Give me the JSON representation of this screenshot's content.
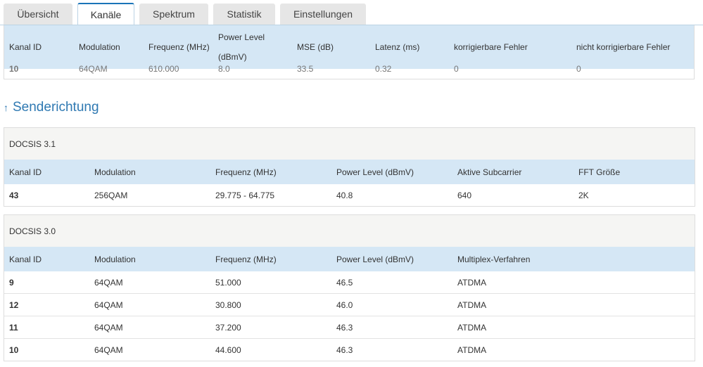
{
  "tabs": [
    {
      "label": "Übersicht",
      "active": false
    },
    {
      "label": "Kanäle",
      "active": true
    },
    {
      "label": "Spektrum",
      "active": false
    },
    {
      "label": "Statistik",
      "active": false
    },
    {
      "label": "Einstellungen",
      "active": false
    }
  ],
  "downstream": {
    "headers": [
      "Kanal ID",
      "Modulation",
      "Frequenz (MHz)",
      "Power Level",
      "(dBmV)",
      "MSE (dB)",
      "Latenz (ms)",
      "korrigierbare Fehler",
      "nicht korrigierbare Fehler"
    ],
    "partial_row": [
      "10",
      "64QAM",
      "610.000",
      "8.0",
      "33.5",
      "0.32",
      "0",
      "0"
    ]
  },
  "upstream": {
    "title": "Senderichtung",
    "arrow": "↑",
    "docsis31": {
      "title": "DOCSIS 3.1",
      "headers": [
        "Kanal ID",
        "Modulation",
        "Frequenz (MHz)",
        "Power Level (dBmV)",
        "Aktive Subcarrier",
        "FFT Größe"
      ],
      "rows": [
        [
          "43",
          "256QAM",
          "29.775 - 64.775",
          "40.8",
          "640",
          "2K"
        ]
      ]
    },
    "docsis30": {
      "title": "DOCSIS 3.0",
      "headers": [
        "Kanal ID",
        "Modulation",
        "Frequenz (MHz)",
        "Power Level (dBmV)",
        "Multiplex-Verfahren"
      ],
      "rows": [
        [
          "9",
          "64QAM",
          "51.000",
          "46.5",
          "ATDMA"
        ],
        [
          "12",
          "64QAM",
          "30.800",
          "46.0",
          "ATDMA"
        ],
        [
          "11",
          "64QAM",
          "37.200",
          "46.3",
          "ATDMA"
        ],
        [
          "10",
          "64QAM",
          "44.600",
          "46.3",
          "ATDMA"
        ]
      ]
    }
  }
}
